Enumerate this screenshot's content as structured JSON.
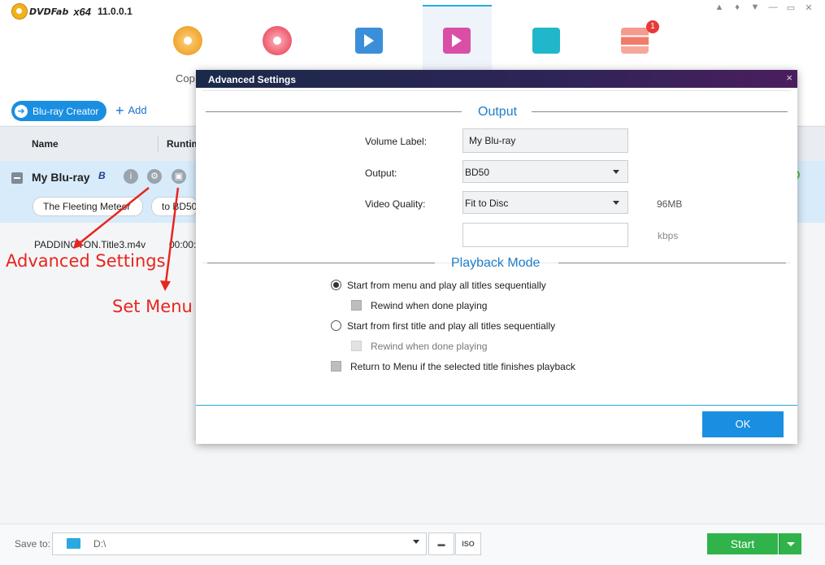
{
  "app": {
    "brand": "DVDFab",
    "arch": "x64",
    "version": "11.0.0.1",
    "window_icons": [
      "bell-icon",
      "shirt-icon",
      "dropdown-icon",
      "minimize-icon",
      "maximize-icon",
      "close-icon"
    ]
  },
  "modules": {
    "copy_label_partial": "Cop",
    "badge_count": "1",
    "items": [
      "copy-disc-icon",
      "ripper-disc-icon",
      "converter-film-icon",
      "creator-film-icon",
      "utilities-plug-icon",
      "task-queue-icon"
    ]
  },
  "toolbar": {
    "creator_label": "Blu-ray Creator",
    "add_label": "Add"
  },
  "list": {
    "col_name": "Name",
    "col_runtime": "Runtim",
    "title_name": "My Blu-ray",
    "bd_logo": "B",
    "pill_1": "The Fleeting Meteor",
    "pill_2": "to BD50",
    "file_name": "PADDINGTON.Title3.m4v",
    "file_runtime": "00:00:2"
  },
  "annotations": {
    "advanced": "Advanced Settings",
    "set_menu": "Set Menu"
  },
  "bottom": {
    "save_label": "Save to:",
    "path": "D:\\",
    "iso_label": "ISO",
    "start_label": "Start"
  },
  "dialog": {
    "title": "Advanced Settings",
    "close": "×",
    "output_section": "Output",
    "volume_label_lbl": "Volume Label:",
    "volume_label_val": "My Blu-ray",
    "output_lbl": "Output:",
    "output_val": "BD50",
    "quality_lbl": "Video Quality:",
    "quality_val": "Fit to Disc",
    "size_val": "96MB",
    "bitrate_val": "",
    "bitrate_unit": "kbps",
    "playback_section": "Playback Mode",
    "opt_menu_seq": "Start from menu and play all titles sequentially",
    "opt_rewind_1": "Rewind when done playing",
    "opt_first_title": "Start from first title and play all titles sequentially",
    "opt_rewind_2": "Rewind when done playing",
    "opt_return_menu": "Return to Menu if the selected title finishes playback",
    "ok_label": "OK"
  },
  "colors": {
    "accent_blue": "#1a8ee0",
    "start_green": "#2fb34a",
    "annotation_red": "#e8251e",
    "section_blue": "#1e7dc8"
  }
}
